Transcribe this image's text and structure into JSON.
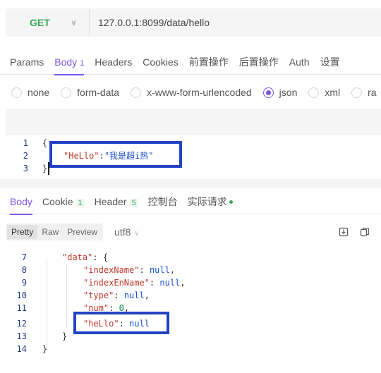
{
  "request": {
    "method": "GET",
    "url": "127.0.0.1:8099/data/hello"
  },
  "request_tabs": [
    {
      "label": "Params",
      "count": ""
    },
    {
      "label": "Body",
      "count": "1"
    },
    {
      "label": "Headers",
      "count": ""
    },
    {
      "label": "Cookies",
      "count": ""
    },
    {
      "label": "前置操作",
      "count": ""
    },
    {
      "label": "后置操作",
      "count": ""
    },
    {
      "label": "Auth",
      "count": ""
    },
    {
      "label": "设置",
      "count": ""
    }
  ],
  "body_types": [
    "none",
    "form-data",
    "x-www-form-urlencoded",
    "json",
    "xml",
    "ra"
  ],
  "body_type_selected": "json",
  "editor": {
    "line_numbers": [
      "1",
      "2",
      "3"
    ],
    "open_brace": "{",
    "close_brace": "}",
    "key": "\"HeLlo\"",
    "colon": ":",
    "value": "\"我是超i热\""
  },
  "response_tabs": [
    {
      "label": "Body",
      "count": ""
    },
    {
      "label": "Cookie",
      "count": "1"
    },
    {
      "label": "Header",
      "count": "5"
    },
    {
      "label": "控制台",
      "count": ""
    },
    {
      "label": "实际请求",
      "count": ""
    }
  ],
  "response_toolbar": {
    "view_modes": [
      "Pretty",
      "Raw",
      "Preview"
    ],
    "selected_view": "Pretty",
    "format": "utf8"
  },
  "response_lines": [
    {
      "num": "7",
      "key": "\"data\"",
      "sep": ": ",
      "val": "{",
      "val_type": "brace"
    },
    {
      "num": "8",
      "key": "\"indexName\"",
      "sep": ": ",
      "val": "null",
      "val_type": "null",
      "tail": ","
    },
    {
      "num": "9",
      "key": "\"indexEnName\"",
      "sep": ": ",
      "val": "null",
      "val_type": "null",
      "tail": ","
    },
    {
      "num": "10",
      "key": "\"type\"",
      "sep": ": ",
      "val": "null",
      "val_type": "null",
      "tail": ","
    },
    {
      "num": "11",
      "key": "\"num\"",
      "sep": ": ",
      "val": "0",
      "val_type": "num",
      "tail": ","
    },
    {
      "num": "12",
      "key": "\"heLlo\"",
      "sep": ": ",
      "val": "null",
      "val_type": "null"
    },
    {
      "num": "13",
      "key": "",
      "sep": "",
      "val": "}",
      "val_type": "brace"
    },
    {
      "num": "14",
      "key": "",
      "sep": "",
      "val": "}",
      "val_type": "brace"
    }
  ],
  "colors": {
    "accent": "#7b55e8",
    "method_green": "#3aa655",
    "highlight_box": "#2342c4",
    "json_key": "#c0392b",
    "json_string": "#1a4fd0"
  }
}
